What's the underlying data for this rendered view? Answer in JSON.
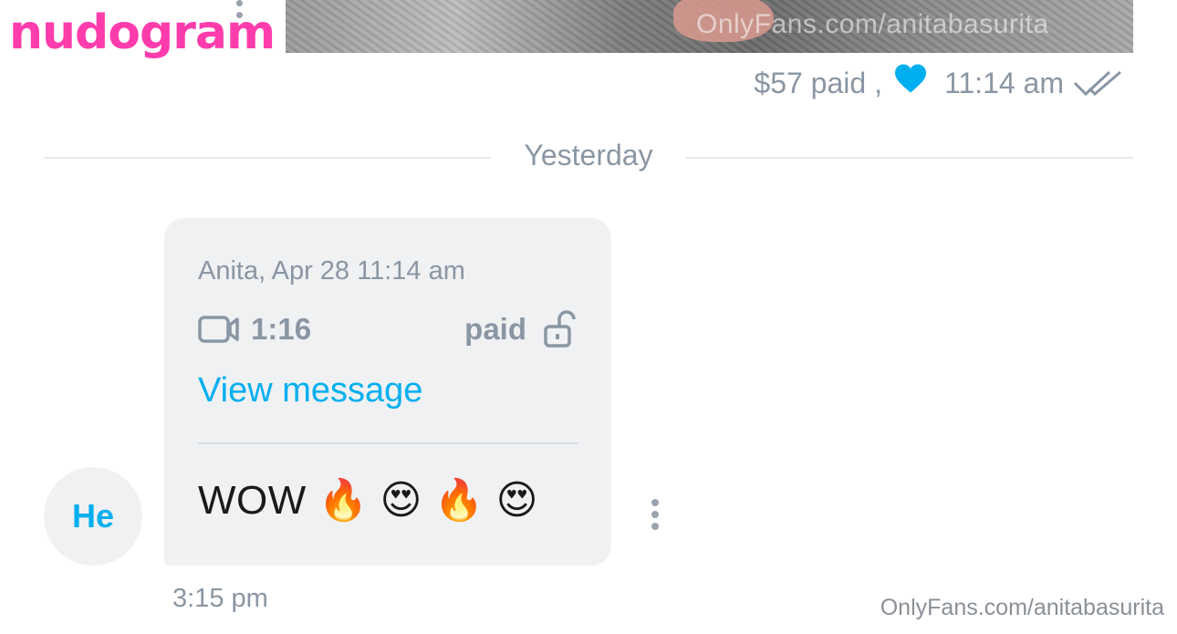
{
  "logo": {
    "text": "nudogram"
  },
  "media_preview": {
    "watermark": "OnlyFans.com/anitabasurita"
  },
  "message_meta": {
    "paid_text": "$57 paid ,",
    "liked_icon": "heart-icon",
    "time": "11:14 am",
    "status_icon": "double-check-icon"
  },
  "date_divider": {
    "label": "Yesterday"
  },
  "message": {
    "header": "Anita, Apr 28 11:14 am",
    "media_icon": "video-icon",
    "duration": "1:16",
    "paid_label": "paid",
    "lock_icon": "unlocked-icon",
    "view_link": "View message",
    "text": "WOW 🔥 😍 🔥 😍",
    "time": "3:15 pm"
  },
  "avatar": {
    "initials": "He"
  },
  "footer": {
    "watermark": "OnlyFans.com/anitabasurita"
  },
  "colors": {
    "accent": "#00aff0",
    "muted_text": "#8a96a3",
    "bubble_bg": "#f0f1f3",
    "logo_pink": "#ff3cac"
  }
}
